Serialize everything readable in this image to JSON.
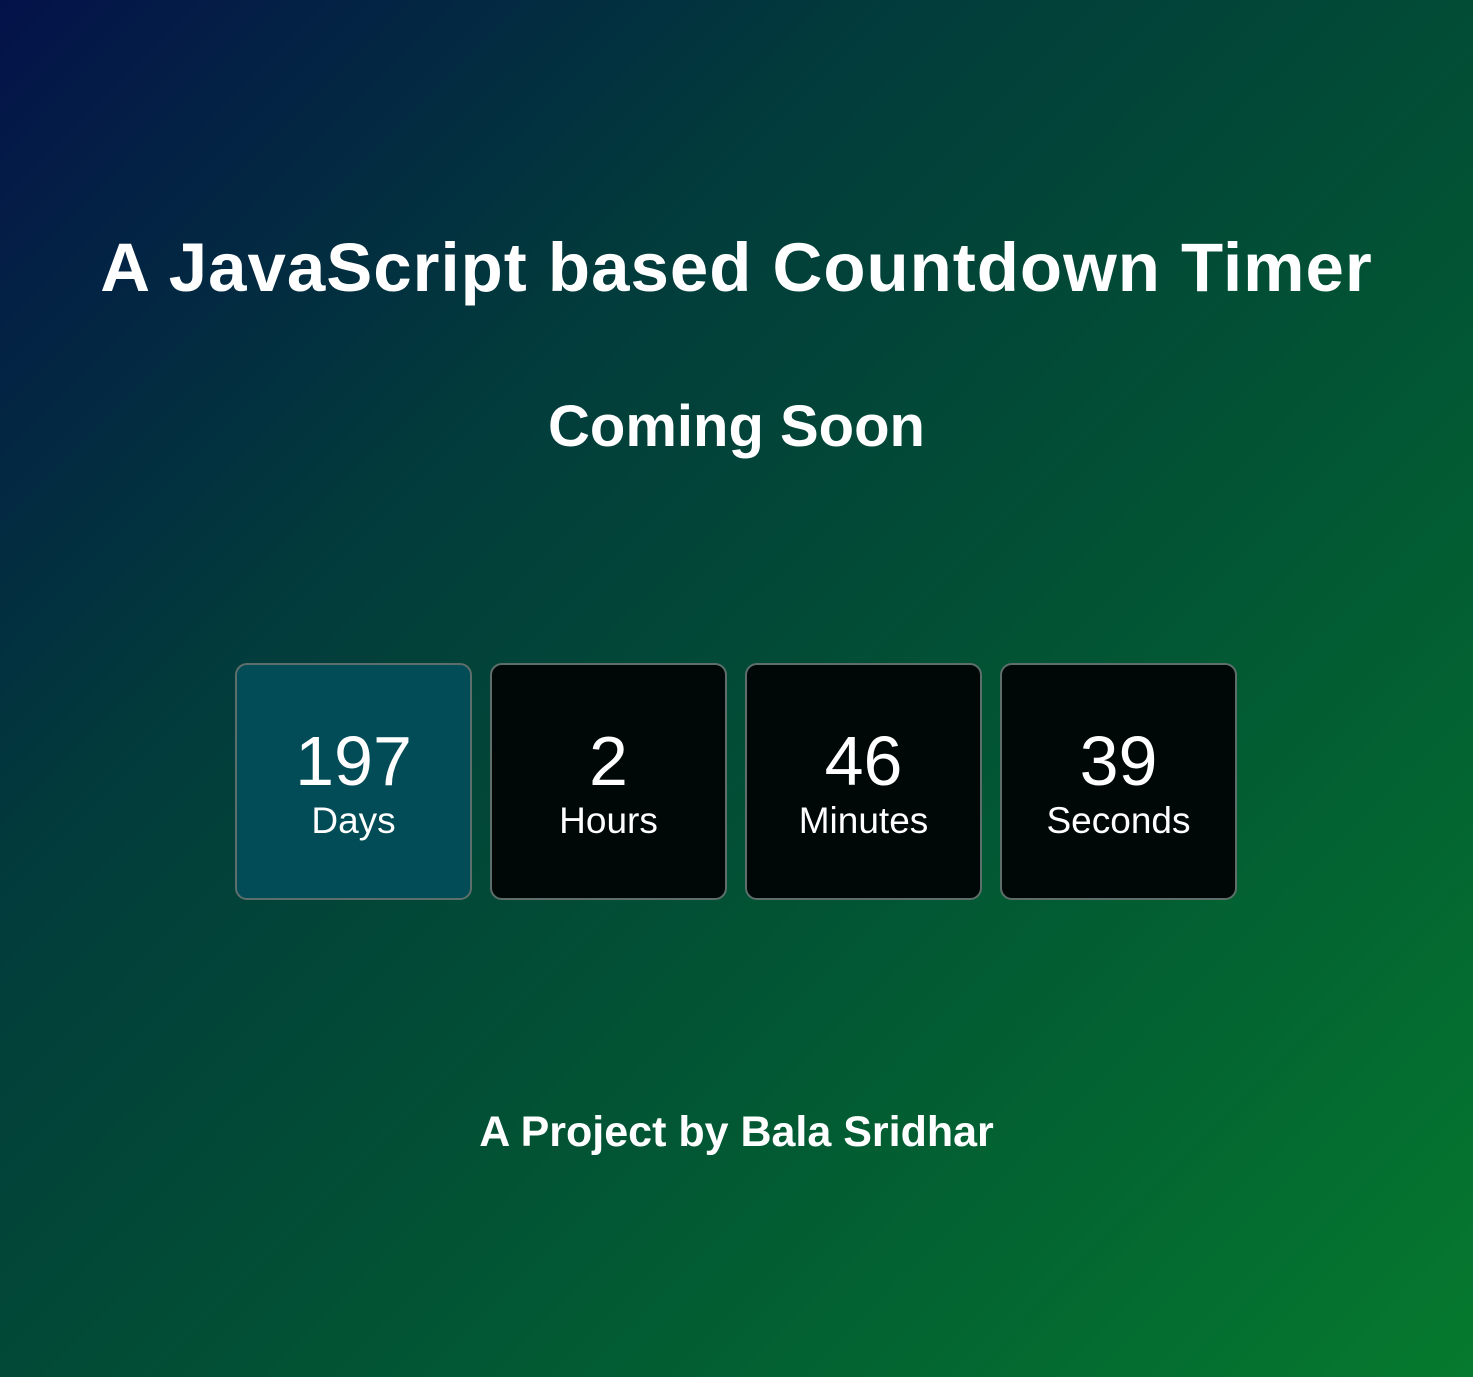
{
  "header": {
    "title": "A JavaScript based Countdown Timer",
    "subtitle": "Coming Soon"
  },
  "countdown": [
    {
      "value": "197",
      "label": "Days"
    },
    {
      "value": "2",
      "label": "Hours"
    },
    {
      "value": "46",
      "label": "Minutes"
    },
    {
      "value": "39",
      "label": "Seconds"
    }
  ],
  "footer": {
    "credit": "A Project by Bala Sridhar"
  },
  "colors": {
    "active_box": "#014c56",
    "box_background": "#000807",
    "gradient_start": "#04124a",
    "gradient_end": "#067a2e"
  }
}
